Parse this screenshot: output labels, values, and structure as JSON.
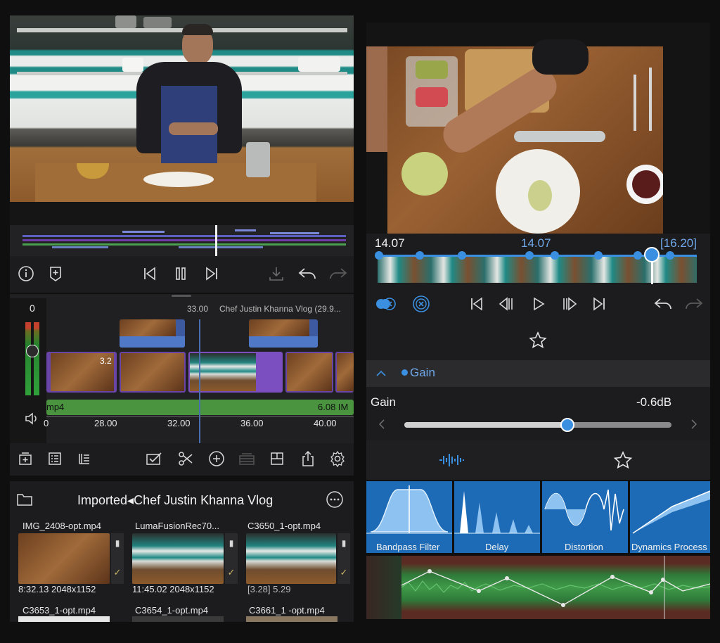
{
  "left": {
    "timeline_icons": {
      "info": "info-icon",
      "marker": "marker-icon",
      "prev": "skip-back-icon",
      "pause": "pause-icon",
      "next": "skip-forward-icon",
      "export": "download-icon",
      "undo": "undo-icon",
      "redo": "redo-icon"
    },
    "level_meter_value": "0",
    "timecode": "33.00",
    "project_title": "Chef Justin Khanna Vlog (29.9...",
    "audio_clip_label": "mp4",
    "audio_clip_size": "6.08 IM",
    "ruler": [
      "0",
      "28.00",
      "32.00",
      "36.00",
      "40.00"
    ],
    "clip_chip_text": "3.2",
    "toolbar": [
      "add-track-icon",
      "list-icon",
      "list-detail-icon",
      "checkbox-icon",
      "scissors-icon",
      "add-circle-icon",
      "layers-icon",
      "layout-icon",
      "share-icon",
      "settings-icon"
    ],
    "library": {
      "title": "Imported◂Chef Justin Khanna Vlog",
      "items": [
        {
          "name": "IMG_2408-opt.mp4",
          "meta": "8:32.13 2048x1152"
        },
        {
          "name": "LumaFusionRec70...",
          "meta": "11:45.02 2048x1152"
        },
        {
          "name": "C3650_1-opt.mp4",
          "meta": "[3.28] 5.29"
        },
        {
          "name": "C3653_1-opt.mp4",
          "meta": ""
        },
        {
          "name": "C3654_1-opt.mp4",
          "meta": ""
        },
        {
          "name": "C3661_1 -opt.mp4",
          "meta": ""
        }
      ]
    }
  },
  "right": {
    "trim_in": "14.07",
    "trim_mid": "14.07",
    "trim_out": "[16.20]",
    "effect_header": "Gain",
    "gain_label": "Gain",
    "gain_value": "-0.6dB",
    "gain_fraction": 0.61,
    "effects": [
      "Bandpass Filter",
      "Delay",
      "Distortion",
      "Dynamics Process"
    ],
    "accent": "#3b8fe0"
  }
}
